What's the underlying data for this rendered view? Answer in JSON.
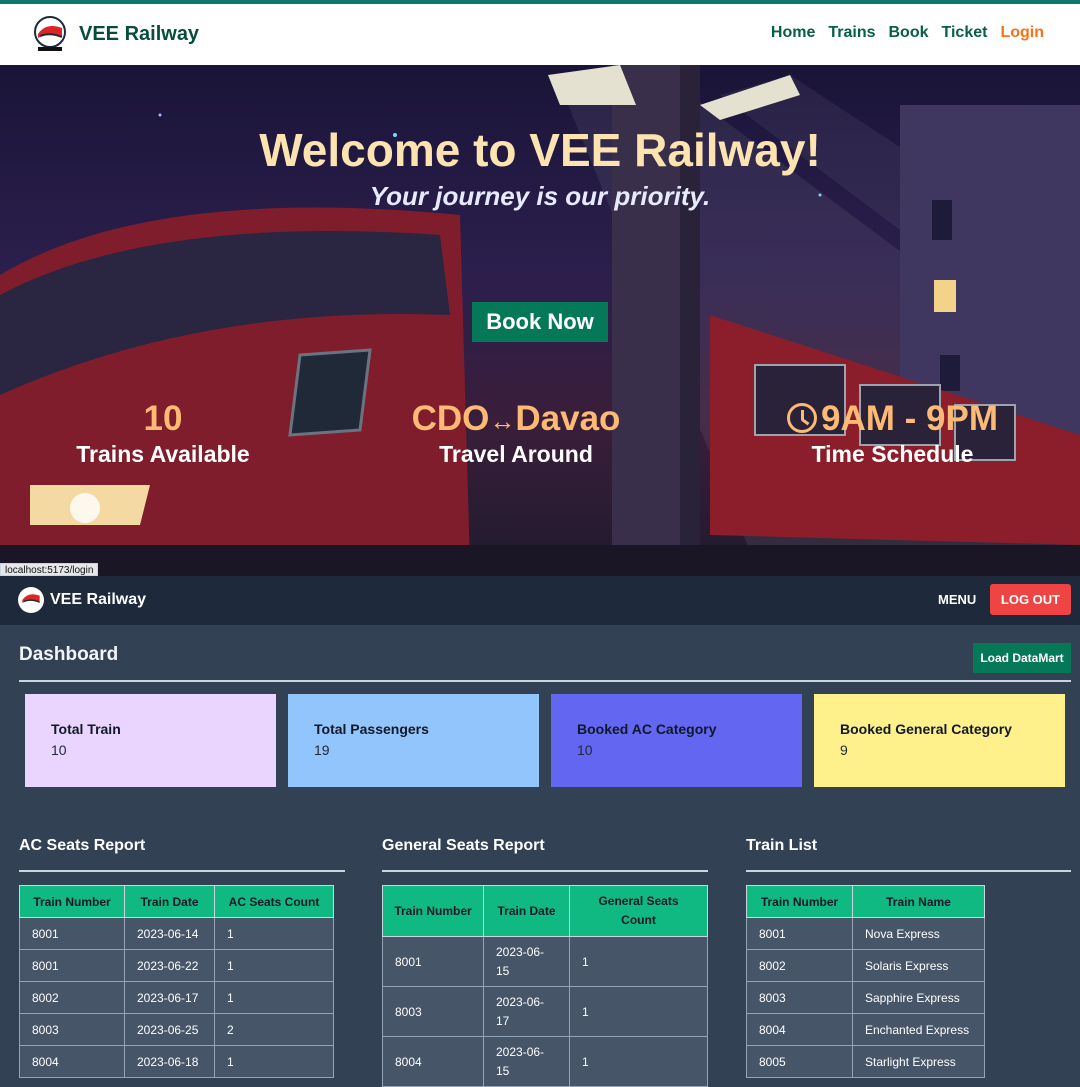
{
  "site": {
    "brand": "VEE Railway",
    "nav": [
      "Home",
      "Trains",
      "Book",
      "Ticket",
      "Login"
    ],
    "hero_title": "Welcome to VEE Railway!",
    "hero_subtitle": "Your journey is our priority.",
    "book_button": "Book Now",
    "stats": [
      {
        "value": "10",
        "label": "Trains Available"
      },
      {
        "value_from": "CDO",
        "arrow": "↔",
        "value_to": "Davao",
        "label": "Travel Around"
      },
      {
        "value": "9AM - 9PM",
        "label": "Time Schedule",
        "icon": "clock-icon"
      }
    ],
    "status_url": "localhost:5173/login"
  },
  "dashboard": {
    "brand": "VEE Railway",
    "menu_label": "MENU",
    "logout_label": "LOG OUT",
    "title": "Dashboard",
    "datamart_button": "Load DataMart",
    "cards": [
      {
        "title": "Total Train",
        "value": "10",
        "color": "#e9d5ff"
      },
      {
        "title": "Total Passengers",
        "value": "19",
        "color": "#93c5fd"
      },
      {
        "title": "Booked AC Category",
        "value": "10",
        "color": "#6366f1"
      },
      {
        "title": "Booked General Category",
        "value": "9",
        "color": "#fef08a"
      }
    ],
    "ac_report": {
      "title": "AC Seats Report",
      "headers": [
        "Train Number",
        "Train Date",
        "AC Seats Count"
      ],
      "rows": [
        [
          "8001",
          "2023-06-14",
          "1"
        ],
        [
          "8001",
          "2023-06-22",
          "1"
        ],
        [
          "8002",
          "2023-06-17",
          "1"
        ],
        [
          "8003",
          "2023-06-25",
          "2"
        ],
        [
          "8004",
          "2023-06-18",
          "1"
        ]
      ]
    },
    "general_report": {
      "title": "General Seats Report",
      "headers": [
        "Train Number",
        "Train Date",
        "General Seats Count"
      ],
      "rows": [
        [
          "8001",
          "2023-06-15",
          "1"
        ],
        [
          "8003",
          "2023-06-17",
          "1"
        ],
        [
          "8004",
          "2023-06-15",
          "1"
        ]
      ]
    },
    "train_list": {
      "title": "Train List",
      "headers": [
        "Train Number",
        "Train Name"
      ],
      "rows": [
        [
          "8001",
          "Nova Express"
        ],
        [
          "8002",
          "Solaris Express"
        ],
        [
          "8003",
          "Sapphire Express"
        ],
        [
          "8004",
          "Enchanted Express"
        ],
        [
          "8005",
          "Starlight Express"
        ]
      ]
    }
  }
}
